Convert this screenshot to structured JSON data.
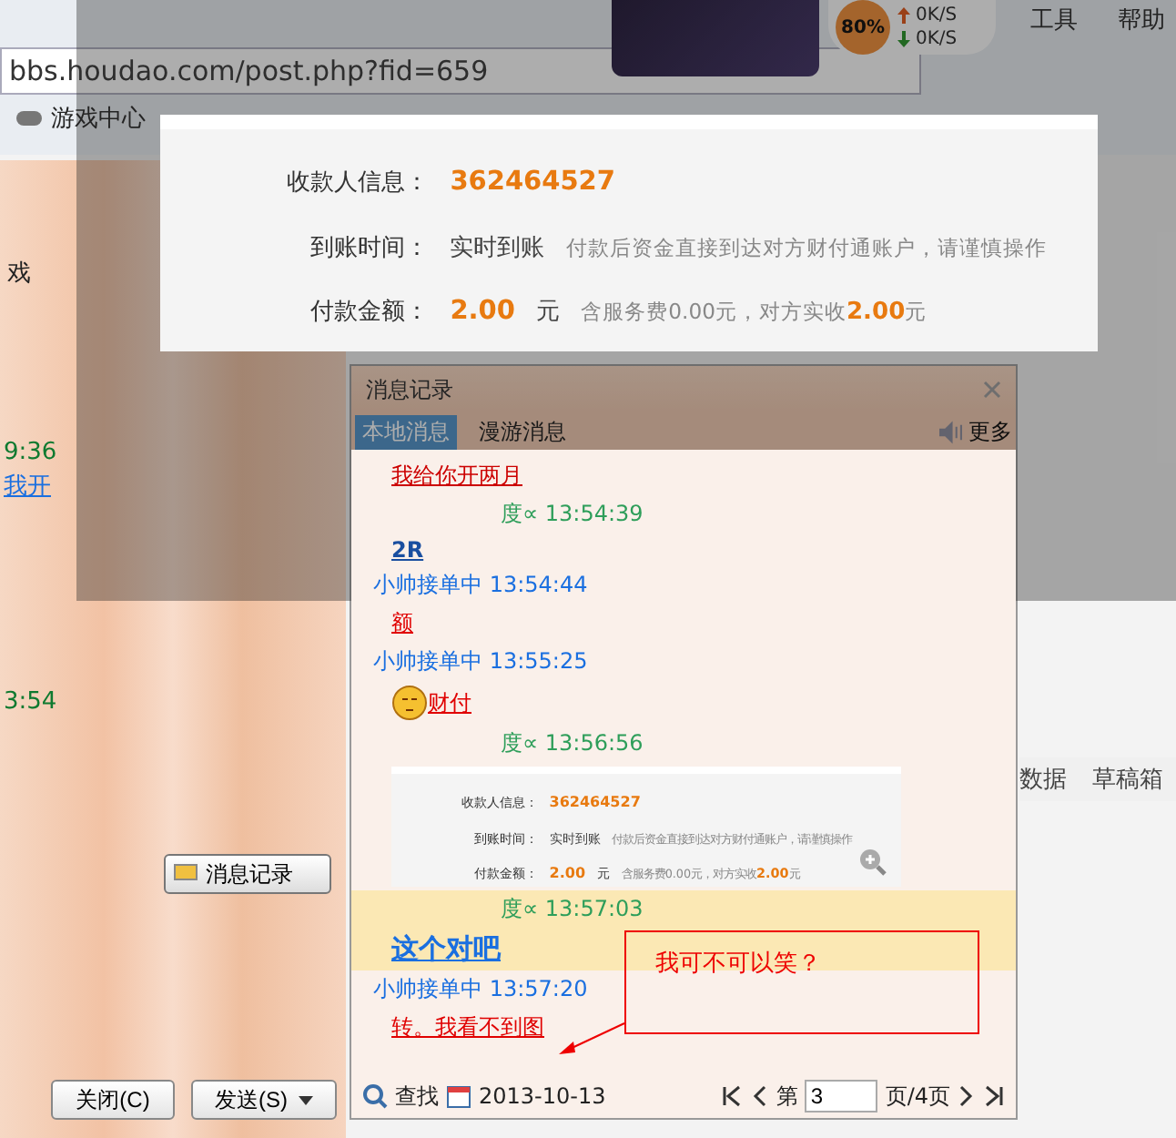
{
  "browser": {
    "address": "bbs.houdao.com/post.php?fid=659",
    "menu": [
      "工具",
      "帮助"
    ],
    "bookmarks": [
      "游戏中心"
    ],
    "network": {
      "percent": "80%",
      "up": "0K/S",
      "down": "0K/S"
    }
  },
  "chat_window": {
    "fragments": [
      {
        "text": "戏",
        "kind": "plain"
      },
      {
        "text": "9:36",
        "kind": "time"
      },
      {
        "text": "我开",
        "kind": "link"
      },
      {
        "text": "3:54",
        "kind": "time"
      }
    ],
    "history_button": "消息记录",
    "close_button": "关闭(C)",
    "send_button": "发送(S)"
  },
  "payment_popup": {
    "rows": [
      {
        "label": "收款人信息：",
        "value": "362464527"
      },
      {
        "label": "到账时间：",
        "value": "实时到账",
        "note": "付款后资金直接到达对方财付通账户，请谨慎操作"
      },
      {
        "label": "付款金额：",
        "value": "2.00",
        "unit": "元",
        "note": "含服务费0.00元，对方实收**2.00**元"
      }
    ]
  },
  "history": {
    "title": "消息记录",
    "tabs": [
      {
        "label": "本地消息",
        "selected": true
      },
      {
        "label": "漫游消息",
        "selected": false
      }
    ],
    "more": "更多",
    "messages": [
      {
        "kind": "text",
        "text": "我给你开两月",
        "color": "#cc0000",
        "highlighted": false
      },
      {
        "kind": "header",
        "text": "度∝ 13:54:39",
        "color": "#2e9e5a",
        "highlighted": false
      },
      {
        "kind": "text",
        "text": "2R",
        "color": "#1a4fa0",
        "highlighted": false
      },
      {
        "kind": "header",
        "text": "小帅接单中 13:54:44",
        "color": "#1a6fe0",
        "highlighted": false
      },
      {
        "kind": "text",
        "text": "额",
        "color": "#e00000",
        "highlighted": false
      },
      {
        "kind": "header",
        "text": "小帅接单中 13:55:25",
        "color": "#1a6fe0",
        "highlighted": false
      },
      {
        "kind": "emoji_text",
        "text": "财付",
        "color": "#e00000",
        "highlighted": false
      },
      {
        "kind": "header",
        "text": "度∝ 13:56:56",
        "color": "#2e9e5a",
        "highlighted": false
      },
      {
        "kind": "image",
        "highlighted": false,
        "rows": [
          {
            "label": "收款人信息：",
            "value": "362464527"
          },
          {
            "label": "到账时间：",
            "value": "实时到账",
            "note": "付款后资金直接到达对方财付通账户，请谨慎操作"
          },
          {
            "label": "付款金额：",
            "value": "2.00",
            "unit": "元",
            "note": "含服务费0.00元，对方实收**2.00**元"
          }
        ]
      },
      {
        "kind": "header",
        "text": "度∝ 13:57:03",
        "color": "#2e9e5a",
        "highlighted": true
      },
      {
        "kind": "big_text",
        "text": "这个对吧",
        "color": "#1a6fe0",
        "highlighted": true
      },
      {
        "kind": "header",
        "text": "小帅接单中 13:57:20",
        "color": "#1a6fe0",
        "highlighted": false
      },
      {
        "kind": "text",
        "text": "转。我看不到图",
        "color": "#e00000",
        "highlighted": false
      }
    ],
    "footer": {
      "search": "查找",
      "date": "2013-10-13",
      "page_prefix": "第",
      "page": "3",
      "page_suffix": "页/4页"
    }
  },
  "annotation": {
    "text": "我可不可以笑？"
  },
  "background_tabs": [
    "数据",
    "草稿箱"
  ]
}
